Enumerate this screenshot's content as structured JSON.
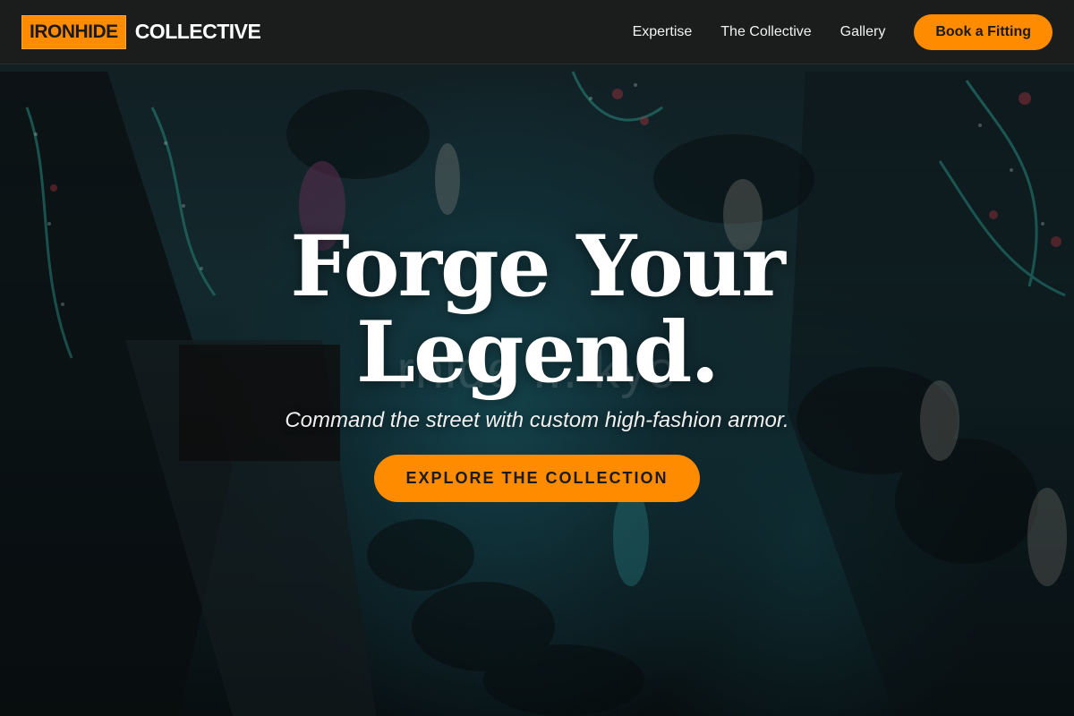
{
  "brand": {
    "mark": "IRONHIDE",
    "word": "COLLECTIVE"
  },
  "nav": {
    "links": [
      "Expertise",
      "The Collective",
      "Gallery"
    ],
    "cta": "Book a Fitting"
  },
  "hero": {
    "headline_line1": "Forge Your",
    "headline_line2": "Legend.",
    "watermark": "rhide ... kyo",
    "subheadline": "Command the street with custom high-fashion armor.",
    "cta": "EXPLORE THE COLLECTION"
  },
  "colors": {
    "accent": "#ff8c00",
    "navbar": "#1c1c1c",
    "text": "#ffffff"
  }
}
